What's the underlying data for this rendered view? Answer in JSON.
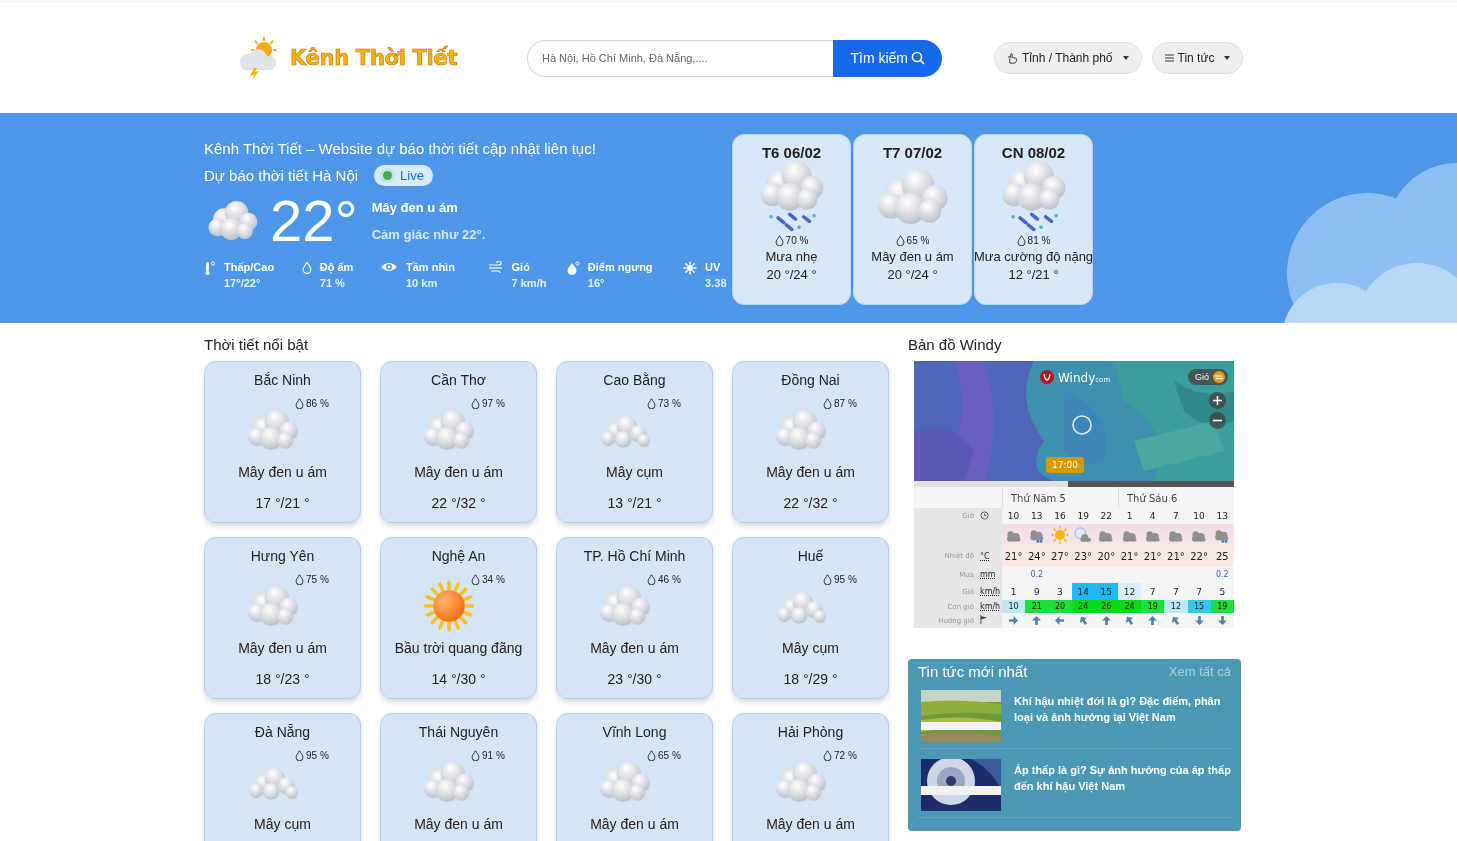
{
  "header": {
    "logo_text": "Kênh Thời Tiết",
    "search": {
      "placeholder": "Hà Nội, Hồ Chí Minh, Đà Nẵng,...."
    },
    "search_button": "Tìm kiếm",
    "menus": [
      {
        "label": "Tỉnh / Thành phố",
        "kind": "hand"
      },
      {
        "label": "Tin tức",
        "kind": "list"
      }
    ]
  },
  "hero": {
    "tagline": "Kênh Thời Tiết – Website dự báo thời tiết cập nhật liên tục!",
    "location_title": "Dự báo thời tiết Hà Nội",
    "live_badge": "Live",
    "current": {
      "kind": "cloudy",
      "temperature": "22°",
      "condition": "Mây đen u ám",
      "feels_like": "Cảm giác như 22°."
    },
    "stats": [
      {
        "kind": "thermometer",
        "label": "Thấp/Cao",
        "value": "17°/22°"
      },
      {
        "kind": "drop",
        "label": "Độ ẩm",
        "value": "71 %"
      },
      {
        "kind": "eye",
        "label": "Tầm nhìn",
        "value": "10 km"
      },
      {
        "kind": "wind",
        "label": "Gió",
        "value": "7 km/h"
      },
      {
        "kind": "dew",
        "label": "Điểm ngưng",
        "value": "16°"
      },
      {
        "kind": "uv",
        "label": "UV",
        "value": "3.38"
      }
    ],
    "forecast": [
      {
        "day": "T6 06/02",
        "kind": "rain",
        "humidity": "70 %",
        "condition": "Mưa nhẹ",
        "temps": "20 °/24 °"
      },
      {
        "day": "T7 07/02",
        "kind": "cloudy",
        "humidity": "65 %",
        "condition": "Mây đen u ám",
        "temps": "20 °/24 °"
      },
      {
        "day": "CN 08/02",
        "kind": "rain",
        "humidity": "81 %",
        "condition": "Mưa cường độ nặng",
        "temps": "12 °/21 °"
      }
    ]
  },
  "featured": {
    "title": "Thời tiết nổi bật",
    "cities": [
      {
        "name": "Bắc Ninh",
        "kind": "cloudy",
        "humidity": "86 %",
        "condition": "Mây đen u ám",
        "temps": "17 °/21 °"
      },
      {
        "name": "Cần Thơ",
        "kind": "cloudy",
        "humidity": "97 %",
        "condition": "Mây đen u ám",
        "temps": "22 °/32 °"
      },
      {
        "name": "Cao Bằng",
        "kind": "clouds",
        "humidity": "73 %",
        "condition": "Mây cụm",
        "temps": "13 °/21 °"
      },
      {
        "name": "Đồng Nai",
        "kind": "cloudy",
        "humidity": "87 %",
        "condition": "Mây đen u ám",
        "temps": "22 °/32 °"
      },
      {
        "name": "Hưng Yên",
        "kind": "cloudy",
        "humidity": "75 %",
        "condition": "Mây đen u ám",
        "temps": "18 °/23 °"
      },
      {
        "name": "Nghệ An",
        "kind": "sun",
        "humidity": "34 %",
        "condition": "Bầu trời quang đãng",
        "temps": "14 °/30 °"
      },
      {
        "name": "TP. Hồ Chí Minh",
        "kind": "cloudy",
        "humidity": "46 %",
        "condition": "Mây đen u ám",
        "temps": "23 °/30 °"
      },
      {
        "name": "Huế",
        "kind": "clouds",
        "humidity": "95 %",
        "condition": "Mây cụm",
        "temps": "18 °/29 °"
      },
      {
        "name": "Đà Nẵng",
        "kind": "clouds",
        "humidity": "95 %",
        "condition": "Mây cụm"
      },
      {
        "name": "Thái Nguyên",
        "kind": "cloudy",
        "humidity": "91 %",
        "condition": "Mây đen u ám"
      },
      {
        "name": "Vĩnh Long",
        "kind": "cloudy",
        "humidity": "65 %",
        "condition": "Mây đen u ám"
      },
      {
        "name": "Hải Phòng",
        "kind": "cloudy",
        "humidity": "72 %",
        "condition": "Mây đen u ám"
      }
    ]
  },
  "windy": {
    "title": "Bản đồ Windy",
    "map": {
      "kind": "picture"
    },
    "logo": "Windy",
    "logo_suffix": "com",
    "layer_button": "Gió",
    "time_marker": "17:00",
    "days": [
      "Thứ Năm 5",
      "Thứ Sáu 6"
    ],
    "rows": [
      {
        "label": "Giờ",
        "kind": "clock"
      },
      {
        "label": "Nhiệt độ",
        "unit": "°C"
      },
      {
        "label": "Mưa",
        "unit": "mm"
      },
      {
        "label": "Gió",
        "unit": "km/h"
      },
      {
        "label": "Cơn gió",
        "unit": "km/h"
      },
      {
        "label": "Hướng gió",
        "kind": "flag"
      }
    ],
    "columns": [
      {
        "hour": "10",
        "kind": "cloud",
        "temp": "21°",
        "wind": "1",
        "gust": "10",
        "direction": {
          "kind": "e"
        }
      },
      {
        "hour": "13",
        "kind": "rain",
        "temp": "24°",
        "rain": "0.2",
        "wind": "9",
        "gust": "21",
        "direction": {
          "kind": "n"
        }
      },
      {
        "hour": "16",
        "kind": "sun",
        "temp": "27°",
        "wind": "3",
        "gust": "20",
        "direction": {
          "kind": "w"
        }
      },
      {
        "hour": "19",
        "kind": "moon",
        "temp": "23°",
        "wind": "14",
        "gust": "24",
        "direction": {
          "kind": "nw"
        }
      },
      {
        "hour": "22",
        "kind": "cloud",
        "temp": "20°",
        "wind": "15",
        "gust": "26",
        "direction": {
          "kind": "n"
        }
      },
      {
        "hour": "1",
        "kind": "cloud",
        "temp": "21°",
        "wind": "12",
        "gust": "24",
        "direction": {
          "kind": "nw"
        }
      },
      {
        "hour": "4",
        "kind": "cloud",
        "temp": "21°",
        "wind": "7",
        "gust": "19",
        "direction": {
          "kind": "n"
        }
      },
      {
        "hour": "7",
        "kind": "cloud",
        "temp": "21°",
        "wind": "7",
        "gust": "12",
        "direction": {
          "kind": "nw"
        }
      },
      {
        "hour": "10",
        "kind": "cloud",
        "temp": "22°",
        "wind": "7",
        "gust": "15",
        "direction": {
          "kind": "s"
        }
      },
      {
        "hour": "13",
        "kind": "rain",
        "temp": "25",
        "rain": "0.2",
        "wind": "5",
        "gust": "19",
        "direction": {
          "kind": "s"
        }
      }
    ]
  },
  "news": {
    "title": "Tin tức mới nhất",
    "view_all": "Xem tất cả",
    "items": [
      {
        "title": "Khí hậu nhiệt đới là gì? Đặc điểm, phân loại và ảnh hưởng tại Việt Nam",
        "kind": "fields"
      },
      {
        "title": "Áp thấp là gì? Sự ảnh hưởng của áp thấp đến khí hậu Việt Nam",
        "kind": "storm"
      }
    ]
  }
}
